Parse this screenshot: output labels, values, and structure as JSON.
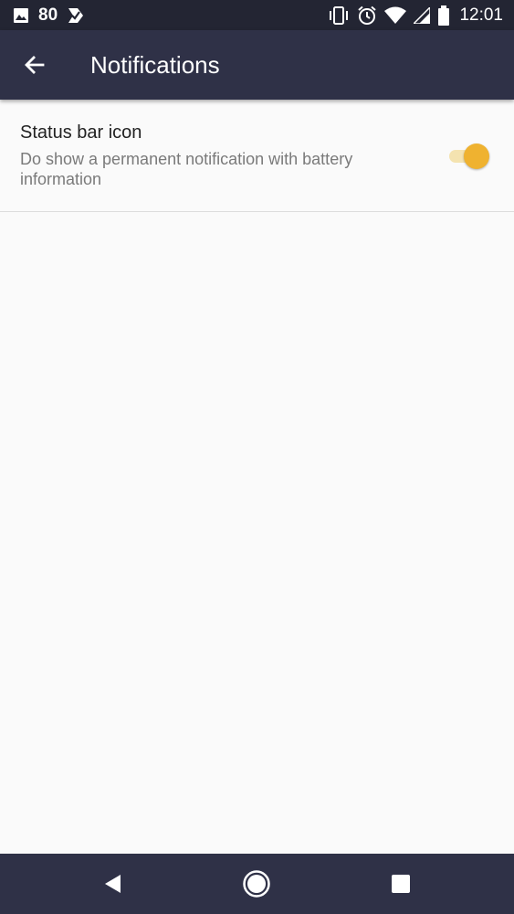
{
  "status_bar": {
    "battery_number": "80",
    "time": "12:01",
    "left_icons": [
      "image-icon",
      "check-badge-icon"
    ],
    "right_icons": [
      "vibrate-icon",
      "alarm-icon",
      "wifi-icon",
      "signal-icon",
      "battery-icon"
    ]
  },
  "app_bar": {
    "title": "Notifications",
    "back_icon": "arrow-back-icon"
  },
  "preferences": [
    {
      "title": "Status bar icon",
      "summary": "Do show a permanent notification with battery information",
      "switch_on": true
    }
  ],
  "nav_bar": {
    "icons": [
      "back-triangle-icon",
      "home-circle-icon",
      "recents-square-icon"
    ]
  },
  "colors": {
    "status_bar_bg": "#232533",
    "app_bar_bg": "#2f3147",
    "content_bg": "#fafafa",
    "accent": "#efb230",
    "accent_track": "#f4e3b0"
  }
}
